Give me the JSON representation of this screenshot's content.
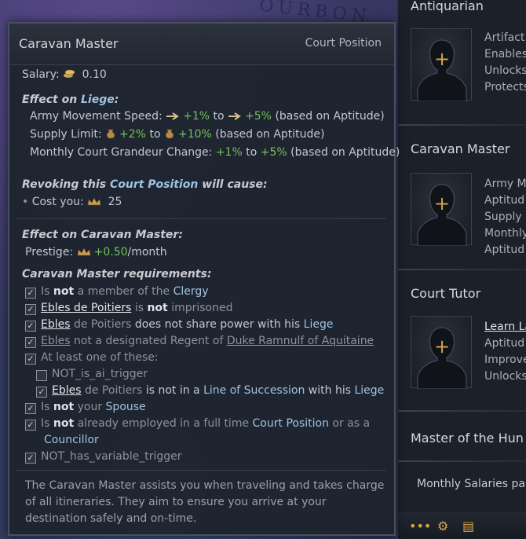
{
  "map": {
    "label": "OURBON"
  },
  "right_panel": {
    "sections": [
      {
        "title": "Antiquarian",
        "lines": [
          "Artifact",
          "Enables",
          "Unlocks",
          "Protects"
        ]
      },
      {
        "title": "Caravan Master",
        "lines": [
          "Army M",
          "Aptitud",
          "Supply L",
          "Monthly",
          "Aptitud"
        ]
      },
      {
        "title": "Court Tutor",
        "lines": [
          "Learn La",
          "Aptitud",
          "Improve",
          "Unlocks"
        ]
      },
      {
        "title": "Master of the Hun",
        "lines": []
      }
    ],
    "footer": "Monthly Salaries paid",
    "bottom_icons": [
      "more-icon",
      "gear-icon",
      "book-icon"
    ]
  },
  "tooltip": {
    "title": "Caravan Master",
    "subtitle": "Court Position",
    "salary_label": "Salary:",
    "salary_value": "0.10",
    "effect_liege_prefix": "Effect on ",
    "effect_liege_target": "Liege",
    "effect_liege_suffix": ":",
    "army_label": "Army Movement Speed:",
    "army_min": "+1%",
    "army_to": "to",
    "army_max": "+5%",
    "army_note": "(based on Aptitude)",
    "supply_label": "Supply Limit:",
    "supply_min": "+2%",
    "supply_to": "to",
    "supply_max": "+10%",
    "supply_note": "(based on Aptitude)",
    "grandeur_label": "Monthly Court Grandeur Change:",
    "grandeur_min": "+1%",
    "grandeur_to": "to",
    "grandeur_max": "+5%",
    "grandeur_note": "(based on Aptitude)",
    "revoke_prefix": "Revoking this ",
    "revoke_target": "Court Position",
    "revoke_suffix": " will cause:",
    "cost_label": "Cost you:",
    "cost_value": "25",
    "effect_cm_header": "Effect on Caravan Master:",
    "prestige_label": "Prestige:",
    "prestige_value": "+0.50",
    "prestige_unit": "/month",
    "requirements_header": "Caravan Master requirements:",
    "requirements": {
      "r1_a": "Is ",
      "r1_b": "not",
      "r1_c": " a member of the ",
      "r1_d": "Clergy",
      "r2_a": "Ebles de Poitiers",
      "r2_b": " is ",
      "r2_c": "not",
      "r2_d": " imprisoned",
      "r3_a": "Ebles",
      "r3_b": " de Poitiers",
      "r3_c": " does not share power with his ",
      "r3_d": "Liege",
      "r4_a": "Ebles",
      "r4_b": " not a designated Regent of ",
      "r4_c": "Duke Ramnulf of Aquitaine",
      "r5": "At least one of these:",
      "r6": "NOT_is_ai_trigger",
      "r7_a": "Ebles",
      "r7_b": " de Poitiers",
      "r7_c": " is not in a ",
      "r7_d": "Line of Succession",
      "r7_e": " with his ",
      "r7_f": "Liege",
      "r8_a": "Is ",
      "r8_b": "not",
      "r8_c": " your ",
      "r8_d": "Spouse",
      "r9_a": "Is ",
      "r9_b": "not",
      "r9_c": " already employed in a full time ",
      "r9_d": "Court Position",
      "r9_e": " or as a",
      "r9_f": "Councillor",
      "r10": "NOT_has_variable_trigger"
    },
    "description": "The Caravan Master assists you when traveling and takes charge of all itineraries. They aim to ensure you arrive at your destination safely and on-time."
  }
}
